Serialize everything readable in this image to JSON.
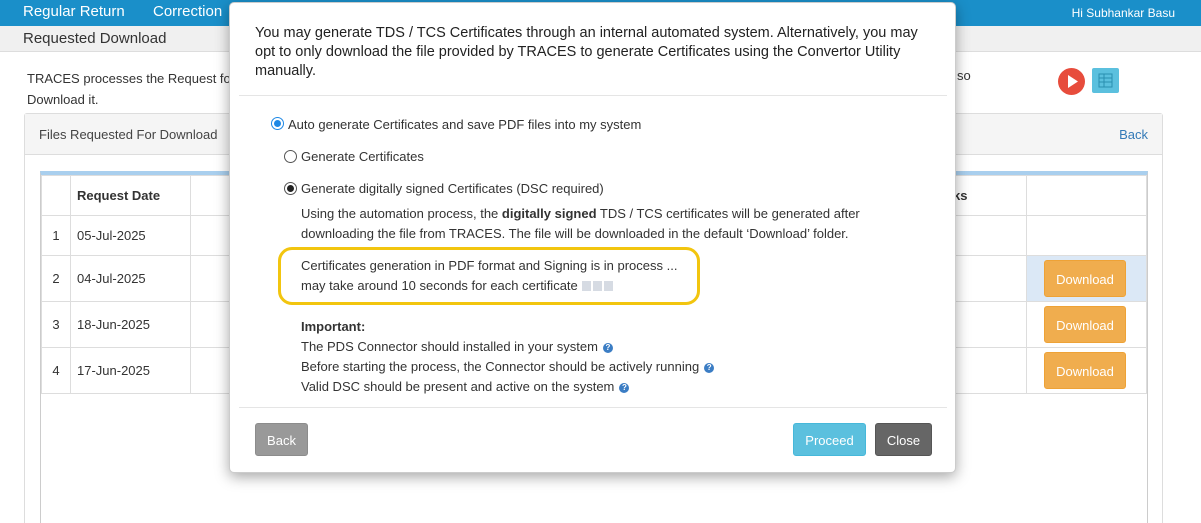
{
  "navbar": {
    "items": [
      "Regular Return",
      "Correction"
    ],
    "greeting": "Hi Subhankar Basu"
  },
  "subbar": {
    "title": "Requested Download"
  },
  "intro": {
    "text_left": "TRACES processes the Request for",
    "text_tail": "so",
    "text_line2": "Download it."
  },
  "panel": {
    "title": "Files Requested For Download",
    "back": "Back"
  },
  "table": {
    "headers": [
      "Request Date",
      "ks"
    ],
    "rows": [
      {
        "num": "1",
        "date": "05-Jul-2025",
        "action": ""
      },
      {
        "num": "2",
        "date": "04-Jul-2025",
        "action": "Download"
      },
      {
        "num": "3",
        "date": "18-Jun-2025",
        "action": "Download"
      },
      {
        "num": "4",
        "date": "17-Jun-2025",
        "action": "Download"
      }
    ]
  },
  "modal": {
    "heading": "You may generate TDS / TCS Certificates through an internal automated system. Alternatively, you may opt to only download the file provided by TRACES to generate Certificates using the Convertor Utility manually.",
    "option_auto": "Auto generate Certificates and save PDF files into my system",
    "option_generate": "Generate Certificates",
    "option_dsc": "Generate digitally signed Certificates (DSC required)",
    "desc_pre": "Using the automation process, the ",
    "desc_bold": "digitally signed",
    "desc_post": " TDS / TCS certificates will be generated after downloading the file from TRACES. The file will be downloaded in the default ‘Download’ folder.",
    "progress_line1": "Certificates generation in PDF format and Signing is in process ...",
    "progress_line2": "may take around 10 seconds for each certificate",
    "important_title": "Important:",
    "important_lines": [
      "The PDS Connector should installed in your system",
      "Before starting the process, the Connector should be actively running",
      "Valid DSC should be present and active on the system"
    ],
    "buttons": {
      "back": "Back",
      "proceed": "Proceed",
      "close": "Close"
    }
  },
  "colors": {
    "navbar": "#1a8fc9",
    "download_button": "#f0ad4e",
    "proceed_button": "#5bc0de",
    "highlight_border": "#f2c50f"
  }
}
